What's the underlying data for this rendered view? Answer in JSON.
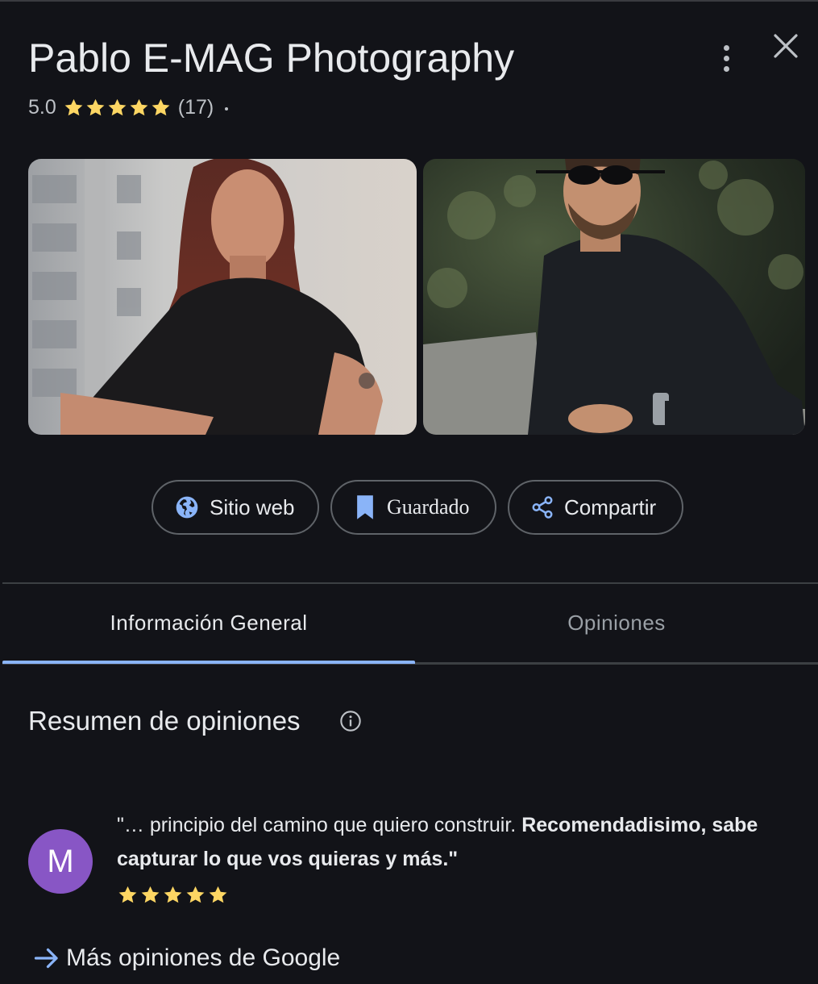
{
  "header": {
    "title": "Pablo E-MAG Photography",
    "rating_value": "5.0",
    "review_count": "(17)",
    "stars": 5
  },
  "photos": [
    {
      "icon": "photo-woman-portrait"
    },
    {
      "icon": "photo-man-portrait"
    }
  ],
  "actions": {
    "website_label": "Sitio web",
    "saved_label": "Guardado",
    "share_label": "Compartir"
  },
  "tabs": [
    {
      "label": "Información General",
      "active": true
    },
    {
      "label": "Opiniones",
      "active": false
    }
  ],
  "summary": {
    "title": "Resumen de opiniones"
  },
  "review": {
    "avatar_letter": "M",
    "avatar_color": "#8856c5",
    "text_plain": "\"… principio del camino que quiero construir. ",
    "text_bold": "Recomendadisimo, sabe capturar lo que vos quieras y más.\"",
    "stars": 5
  },
  "more_link": "Más opiniones de Google",
  "colors": {
    "accent": "#8ab4f8",
    "star": "#fdd663",
    "background": "#121318"
  }
}
